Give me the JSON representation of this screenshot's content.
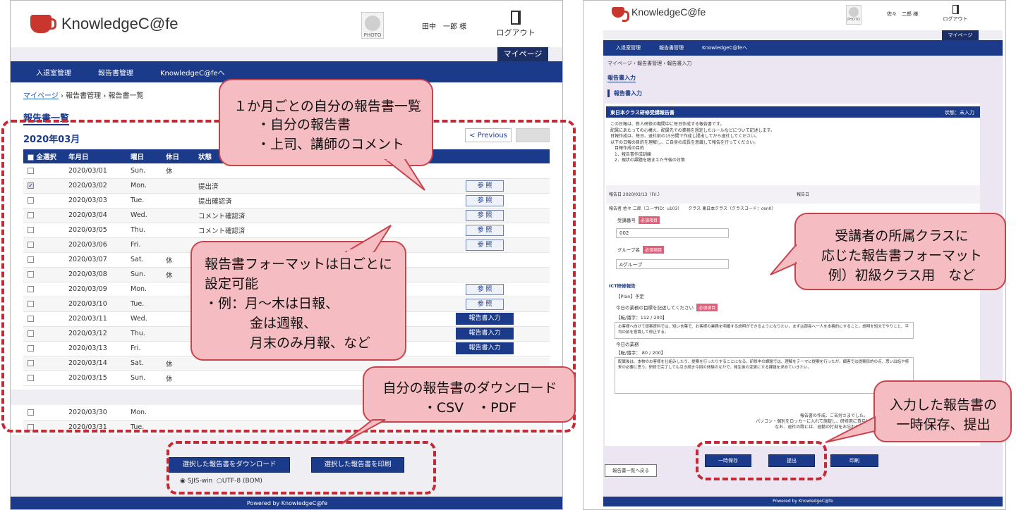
{
  "left": {
    "logo": "KnowledgeC@fe",
    "photo": "PHOTO",
    "user": "田中　一郎 様",
    "logout": "ログアウト",
    "mypage": "マイページ",
    "nav": [
      "入退室管理",
      "報告書管理",
      "KnowledgeC@feへ"
    ],
    "crumb": {
      "home": "マイページ",
      "sep": " › ",
      "mid": "報告書管理",
      "cur": "報告書一覧"
    },
    "title": "報告書一覧",
    "month": "2020年03月",
    "prev": "< Previous",
    "cols": [
      "全選択",
      "年月日",
      "曜日",
      "休日",
      "状態"
    ],
    "rows": [
      {
        "date": "2020/03/01",
        "dow": "Sun.",
        "hol": "休",
        "status": "",
        "btn": "",
        "chk": false
      },
      {
        "date": "2020/03/02",
        "dow": "Mon.",
        "hol": "",
        "status": "提出済",
        "btn": "参 照",
        "chk": true
      },
      {
        "date": "2020/03/03",
        "dow": "Tue.",
        "hol": "",
        "status": "提出確認済",
        "btn": "参 照",
        "chk": false
      },
      {
        "date": "2020/03/04",
        "dow": "Wed.",
        "hol": "",
        "status": "コメント確認済",
        "btn": "参 照",
        "chk": false
      },
      {
        "date": "2020/03/05",
        "dow": "Thu.",
        "hol": "",
        "status": "コメント確認済",
        "btn": "参 照",
        "chk": false
      },
      {
        "date": "2020/03/06",
        "dow": "Fri.",
        "hol": "",
        "status": "",
        "btn": "参 照",
        "chk": false
      },
      {
        "date": "2020/03/07",
        "dow": "Sat.",
        "hol": "休",
        "status": "",
        "btn": "",
        "chk": false
      },
      {
        "date": "2020/03/08",
        "dow": "Sun.",
        "hol": "休",
        "status": "",
        "btn": "",
        "chk": false
      },
      {
        "date": "2020/03/09",
        "dow": "Mon.",
        "hol": "",
        "status": "",
        "btn": "参 照",
        "chk": false
      },
      {
        "date": "2020/03/10",
        "dow": "Tue.",
        "hol": "",
        "status": "",
        "btn": "参 照",
        "chk": false
      },
      {
        "date": "2020/03/11",
        "dow": "Wed.",
        "hol": "",
        "status": "",
        "btn": "報告書入力",
        "chk": false
      },
      {
        "date": "2020/03/12",
        "dow": "Thu.",
        "hol": "",
        "status": "",
        "btn": "報告書入力",
        "chk": false
      },
      {
        "date": "2020/03/13",
        "dow": "Fri.",
        "hol": "",
        "status": "",
        "btn": "報告書入力",
        "chk": false
      },
      {
        "date": "2020/03/14",
        "dow": "Sat.",
        "hol": "休",
        "status": "",
        "btn": "",
        "chk": false
      },
      {
        "date": "2020/03/15",
        "dow": "Sun.",
        "hol": "休",
        "status": "",
        "btn": "",
        "chk": false
      }
    ],
    "rows2": [
      {
        "date": "2020/03/30",
        "dow": "Mon."
      },
      {
        "date": "2020/03/31",
        "dow": "Tue."
      }
    ],
    "dl_btn": "選択した報告書をダウンロード",
    "print_btn": "選択した報告書を印刷",
    "radio1": "SJIS-win",
    "radio2": "UTF-8 (BOM)",
    "footer": "Powered by KnowledgeC@fe"
  },
  "right": {
    "logo": "KnowledgeC@fe",
    "photo": "PHOTO",
    "user": "佐々　二郎 様",
    "logout": "ログアウト",
    "mypage": "マイページ",
    "nav": [
      "入退室管理",
      "報告書管理",
      "KnowledgeC@feへ"
    ],
    "crumb": "マイページ › 報告書管理 › 報告書入力",
    "title": "報告書入力",
    "subtitle": "報告書入力",
    "form_title": "東日本クラス研修受講報告書",
    "status": "状態：未入力",
    "desc": [
      "この日報は、新人研修の期間中に毎日作成する報告書です。",
      "配属にあたっての心構え、配属先での業務を想定したルールなどについて記述します。",
      "日報作成は、毎日、退社前の15分間で作成し提出してから退社してください。",
      "以下の日報の目的を理解し、ご自身の成長を意識して報告を行ってください。",
      "　目報作成の目的",
      "　1．報告書作成訓練",
      "　2．現状の課題を踏まえた今後の対策"
    ],
    "rep_date": "報告日 2020/03/13（Fri.）",
    "rep_week": "報告日",
    "reporter": "報告者 佐々 二郎（ユーザID：u103）　　クラス 東日本クラス（クラスコード：cen0）",
    "label_no": "受講番号",
    "val_no": "002",
    "label_group": "グループ名",
    "val_group": "Aグループ",
    "req": "必須項目",
    "section": "ICT研修報告",
    "plan": "【Plan】予定",
    "q1": "今日の業務の目標を記述してください",
    "count1": "【転/識字：112 / 200】",
    "ans1": "お客様へ向けて提案資料では、短い言葉で、お客様の業務を明確する説明ができるようになりたい。まずは部長へ一人を本格的にすること。説明を短文でやりこと、平均の前を意識して修正する。",
    "q2": "今日の業務",
    "count2": "【転/識字：  80 / 200】",
    "ans2": "配属後は、本物のお客様を仕組みしたり、提案を行ったりすることになる。研修中の課題では、理解をテーマに提案を行ったが、顧客では提案目的の点、思い出話や将来の必要に思う。研修で完了しても引き続き今回の体験のなかで、発生後の変更にする課題を求めていきたい。",
    "footnote1": "報告書の作成、ご苦労さまでした。",
    "footnote2": "パソコン・個別をロッカーに入れて施錠し、研修用に貸与した指示書いことを確認",
    "footnote3": "なお、退社の際には、退勤の打刻をお忘れなく行ってください",
    "btn_save": "一時保存",
    "btn_submit": "提出",
    "btn_print": "印刷",
    "btn_back": "報告書一覧へ戻る",
    "footer": "Powered by KnowledgeC@fe"
  },
  "callouts": {
    "c1": {
      "line1": "１か月ごとの自分の報告書一覧",
      "line2": "・自分の報告書",
      "line3": "・上司、講師のコメント"
    },
    "c2": {
      "line1": "報告書フォーマットは日ごとに",
      "line2": "設定可能",
      "line3": "・例：月～木は日報、",
      "line4": "金は週報、",
      "line5": "月末のみ月報、など"
    },
    "c3": {
      "line1": "自分の報告書のダウンロード",
      "line2": "・CSV　・PDF"
    },
    "c4": {
      "line1": "受講者の所属クラスに",
      "line2": "応じた報告書フォーマット",
      "line3": "例）初級クラス用　など"
    },
    "c5": {
      "line1": "入力した報告書の",
      "line2": "一時保存、提出"
    }
  },
  "colors": {
    "navy": "#1b3b8a",
    "callout_fill": "#f5bdc2",
    "callout_border": "#c9434d",
    "dash": "#c32a36",
    "lilac": "#ece6f2"
  }
}
